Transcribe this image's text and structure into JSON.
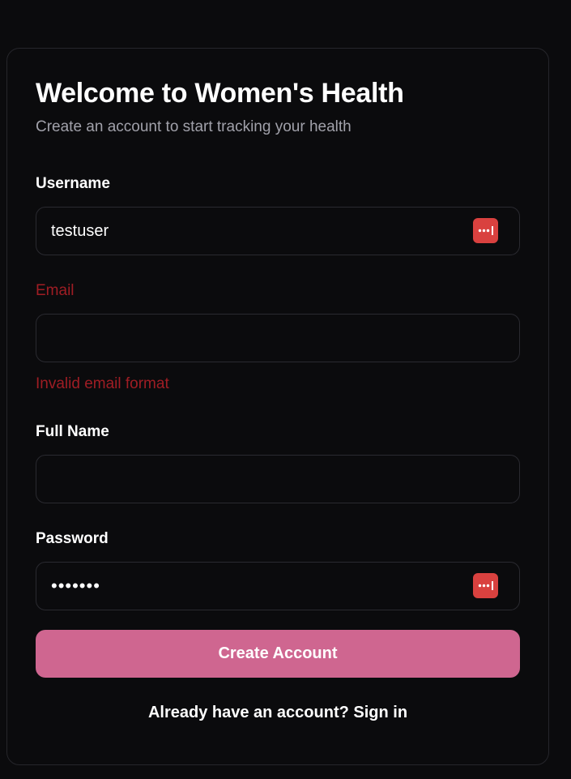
{
  "header": {
    "title": "Welcome to Women's Health",
    "subtitle": "Create an account to start tracking your health"
  },
  "form": {
    "username": {
      "label": "Username",
      "value": "testuser"
    },
    "email": {
      "label": "Email",
      "value": "",
      "error": "Invalid email format"
    },
    "full_name": {
      "label": "Full Name",
      "value": ""
    },
    "password": {
      "label": "Password",
      "value": "•••••••"
    },
    "submit_label": "Create Account"
  },
  "footer": {
    "prompt": "Already have an account? ",
    "link": "Sign in"
  },
  "icons": {
    "password_manager": "password-manager-icon"
  },
  "colors": {
    "background": "#0b0b0d",
    "card_border": "#26262b",
    "accent_button": "#cf6690",
    "error": "#9f1d24",
    "password_manager": "#d9413f",
    "muted_text": "#a1a1aa"
  }
}
